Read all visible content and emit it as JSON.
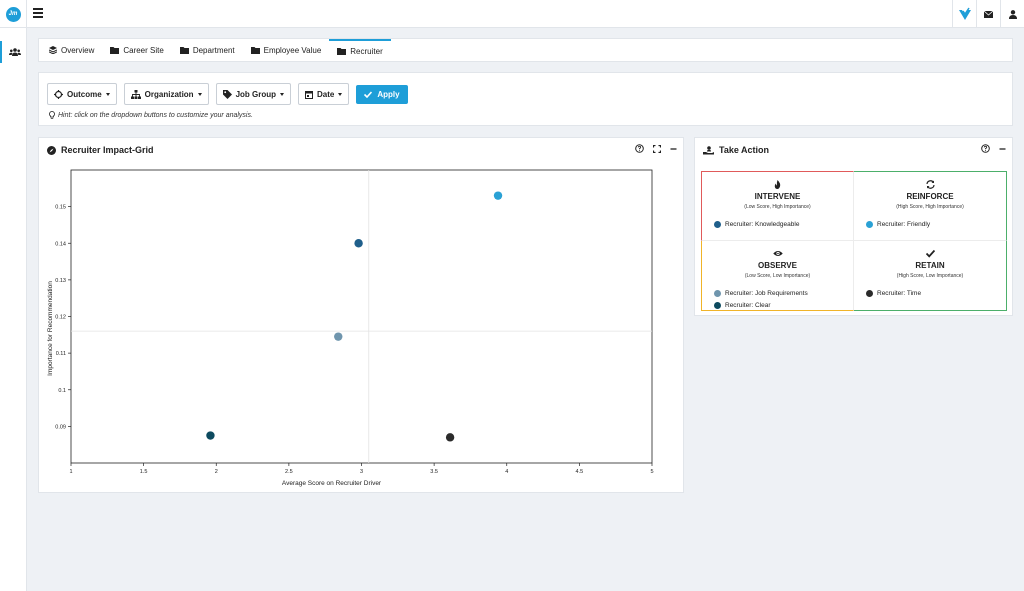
{
  "app": {
    "logo_text": "Jm"
  },
  "tabs": [
    {
      "label": "Overview",
      "icon": "layers-icon",
      "active": false
    },
    {
      "label": "Career Site",
      "icon": "folder-icon",
      "active": false
    },
    {
      "label": "Department",
      "icon": "folder-icon",
      "active": false
    },
    {
      "label": "Employee Value",
      "icon": "folder-icon",
      "active": false
    },
    {
      "label": "Recruiter",
      "icon": "folder-icon",
      "active": true
    }
  ],
  "filters": {
    "outcome": "Outcome",
    "organization": "Organization",
    "job_group": "Job Group",
    "date": "Date",
    "apply": "Apply",
    "hint": "Hint: click on the dropdown buttons to customize your analysis."
  },
  "impact_grid": {
    "title": "Recruiter Impact-Grid"
  },
  "take_action": {
    "title": "Take Action",
    "intervene": {
      "title": "INTERVENE",
      "subtitle": "(Low Score, High Importance)",
      "items": [
        "Recruiter: Knowledgeable"
      ]
    },
    "reinforce": {
      "title": "REINFORCE",
      "subtitle": "(High Score, High Importance)",
      "items": [
        "Recruiter: Friendly"
      ]
    },
    "observe": {
      "title": "OBSERVE",
      "subtitle": "(Low Score, Low Importance)",
      "items": [
        "Recruiter: Job Requirements",
        "Recruiter: Clear"
      ]
    },
    "retain": {
      "title": "RETAIN",
      "subtitle": "(High Score, Low Importance)",
      "items": [
        "Recruiter: Time"
      ]
    }
  },
  "colors": {
    "accent": "#1e9ed8",
    "knowledgeable": "#1f5f8b",
    "friendly": "#2aa1d5",
    "job_requirements": "#6f95ad",
    "clear": "#0d4a5f",
    "time": "#2b2b2b"
  },
  "chart_data": {
    "type": "scatter",
    "xlabel": "Average Score on Recruiter Driver",
    "ylabel": "Importance for Recommendation",
    "xlim": [
      1,
      5
    ],
    "ylim": [
      0.08,
      0.16
    ],
    "x_ticks": [
      "1",
      "1.5",
      "2",
      "2.5",
      "3",
      "3.5",
      "4",
      "4.5",
      "5"
    ],
    "y_ticks": [
      "0.09",
      "0.1",
      "0.11",
      "0.12",
      "0.13",
      "0.14",
      "0.15"
    ],
    "quadrant_x": 3.05,
    "quadrant_y": 0.116,
    "points": [
      {
        "label": "Recruiter: Knowledgeable",
        "x": 2.98,
        "y": 0.14,
        "color": "#1f5f8b"
      },
      {
        "label": "Recruiter: Friendly",
        "x": 3.94,
        "y": 0.153,
        "color": "#2aa1d5"
      },
      {
        "label": "Recruiter: Job Requirements",
        "x": 2.84,
        "y": 0.1145,
        "color": "#6f95ad"
      },
      {
        "label": "Recruiter: Clear",
        "x": 1.96,
        "y": 0.0875,
        "color": "#0d4a5f"
      },
      {
        "label": "Recruiter: Time",
        "x": 3.61,
        "y": 0.087,
        "color": "#2b2b2b"
      }
    ]
  }
}
